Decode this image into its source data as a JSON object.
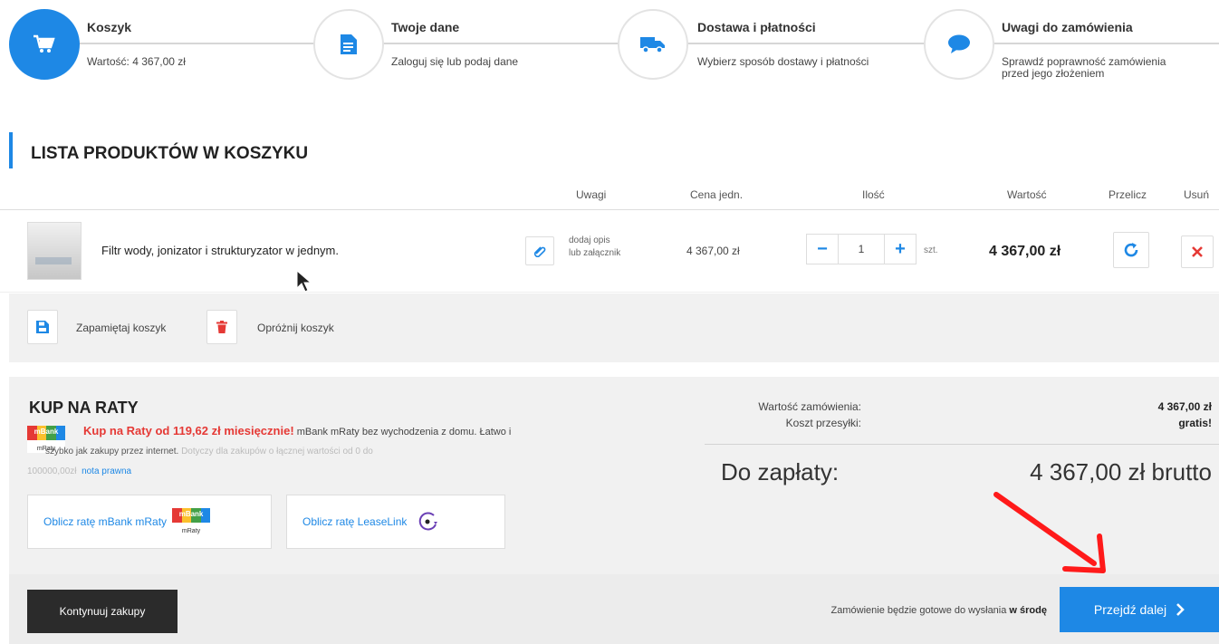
{
  "steps": [
    {
      "title": "Koszyk",
      "desc_lines": [
        "Wartość: 4 367,00 zł"
      ],
      "icon": "cart-icon",
      "active": true
    },
    {
      "title": "Twoje dane",
      "desc_lines": [
        "Zaloguj się lub podaj dane"
      ],
      "icon": "document-icon",
      "active": false
    },
    {
      "title": "Dostawa i płatności",
      "desc_lines": [
        "Wybierz sposób dostawy i płatności"
      ],
      "icon": "truck-icon",
      "active": false
    },
    {
      "title": "Uwagi do zamówienia",
      "desc_lines": [
        "Sprawdź poprawność zamówienia",
        "przed jego złożeniem"
      ],
      "icon": "chat-bubble-icon",
      "active": false
    }
  ],
  "section_title": "LISTA PRODUKTÓW W KOSZYKU",
  "table": {
    "headers": {
      "notes": "Uwagi",
      "unit_price": "Cena jedn.",
      "quantity": "Ilość",
      "value": "Wartość",
      "recalc": "Przelicz",
      "remove": "Usuń"
    },
    "rows": [
      {
        "name": "Filtr wody, jonizator i strukturyzator w jednym.",
        "note_lines": [
          "dodaj opis",
          "lub załącznik"
        ],
        "unit_price": "4 367,00 zł",
        "quantity": "1",
        "unit": "szt.",
        "value": "4 367,00 zł"
      }
    ]
  },
  "cart_actions": {
    "save": "Zapamiętaj koszyk",
    "clear": "Opróżnij koszyk"
  },
  "installments": {
    "title": "KUP NA RATY",
    "highlight": "Kup na Raty od 119,62 zł miesięcznie!",
    "line1_rest": " mBank mRaty bez wychodzenia z domu. Łatwo i",
    "line2_text": "szybko jak zakupy przez internet.",
    "line2_faded": " Dotyczy dla zakupów o łącznej wartości od 0 do",
    "line3_faded": "100000,00zł",
    "legal_link": "nota prawna",
    "logo_text": "mBank",
    "logo_sub": "mRaty",
    "logo_colors": [
      "#e53935",
      "#fbc02d",
      "#43a047",
      "#1e88e5"
    ],
    "btn_mbank": "Oblicz ratę mBank mRaty",
    "btn_leaselink": "Oblicz ratę LeaseLink"
  },
  "summary": {
    "order_value_label": "Wartość zamówienia:",
    "order_value": "4 367,00 zł",
    "shipping_label": "Koszt przesyłki:",
    "shipping_value": "gratis!",
    "to_pay_label": "Do zapłaty:",
    "to_pay_value": "4 367,00 zł brutto"
  },
  "footer": {
    "continue": "Kontynuuj zakupy",
    "ready_prefix": "Zamówienie będzie gotowe do wysłania ",
    "ready_day": "w środę",
    "next": "Przejdź dalej"
  },
  "colors": {
    "accent": "#1e88e5",
    "danger": "#e53935",
    "dark": "#2b2b2b",
    "annotation_arrow": "#ff1a1a"
  }
}
